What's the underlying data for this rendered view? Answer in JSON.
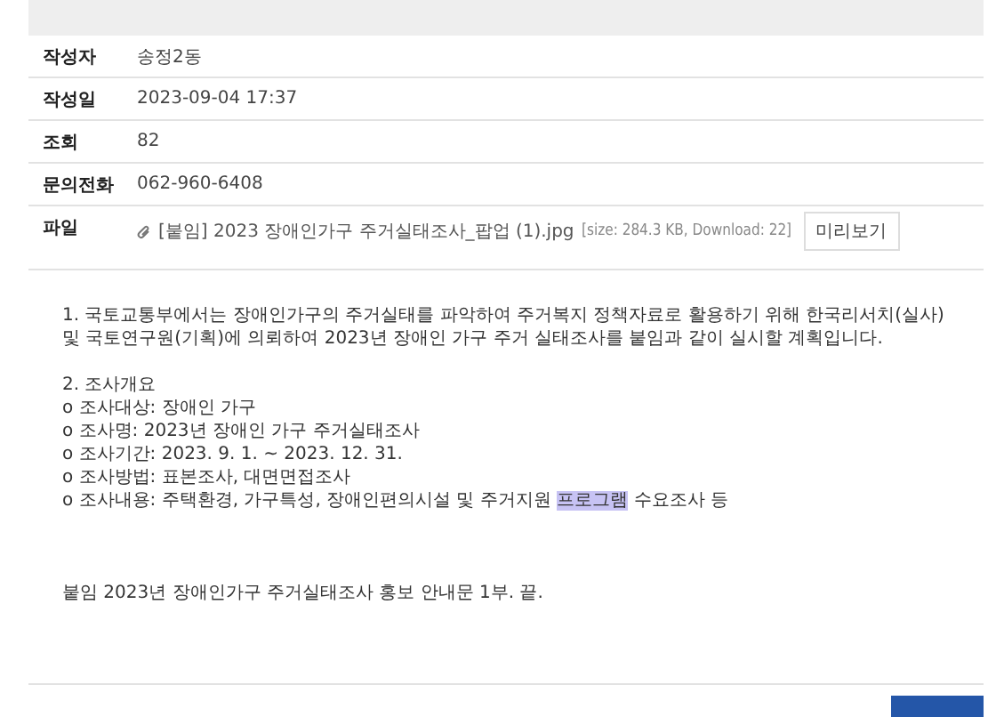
{
  "info": [
    {
      "label": "작성자",
      "value": "송정2동"
    },
    {
      "label": "작성일",
      "value": "2023-09-04 17:37"
    },
    {
      "label": "조회",
      "value": "82"
    },
    {
      "label": "문의전화",
      "value": "062-960-6408"
    }
  ],
  "file": {
    "label": "파일",
    "name": "[붙임] 2023 장애인가구 주거실태조사_팝업 (1).jpg",
    "meta": "[size: 284.3 KB, Download: 22]",
    "preview_button": "미리보기"
  },
  "body": [
    {
      "kind": "paragraph",
      "segments": [
        {
          "text": "1. 국토교통부에서는 장애인가구의 주거실태를 파악하여 주거복지 정책자료로 활용하기 위해 한국리서치(실사) 및 국토연구원(기획)에 의뢰하여 2023년 장애인 가구 주거 실태조사를 붙임과 같이 실시할 계획입니다.",
          "selected": false
        }
      ]
    },
    {
      "kind": "gap"
    },
    {
      "kind": "line",
      "segments": [
        {
          "text": "2. 조사개요",
          "selected": false
        }
      ]
    },
    {
      "kind": "line",
      "segments": [
        {
          "text": "o 조사대상: 장애인 가구",
          "selected": false
        }
      ]
    },
    {
      "kind": "line",
      "segments": [
        {
          "text": "o 조사명: 2023년 장애인 가구 주거실태조사",
          "selected": false
        }
      ]
    },
    {
      "kind": "line",
      "segments": [
        {
          "text": "o 조사기간: 2023. 9. 1. ~ 2023. 12. 31.",
          "selected": false
        }
      ]
    },
    {
      "kind": "line",
      "segments": [
        {
          "text": "o 조사방법: 표본조사, 대면면접조사",
          "selected": false
        }
      ]
    },
    {
      "kind": "line",
      "segments": [
        {
          "text": "o 조사내용: 주택환경, 가구특성, 장애인편의시설 및 주거지원 ",
          "selected": false
        },
        {
          "text": "프로그램",
          "selected": true
        },
        {
          "text": " 수요조사 등",
          "selected": false
        }
      ]
    },
    {
      "kind": "gap"
    },
    {
      "kind": "gap"
    },
    {
      "kind": "gap"
    },
    {
      "kind": "line",
      "segments": [
        {
          "text": "붙임 2023년 장애인가구 주거실태조사 홍보 안내문 1부. 끝.",
          "selected": false
        }
      ]
    }
  ]
}
